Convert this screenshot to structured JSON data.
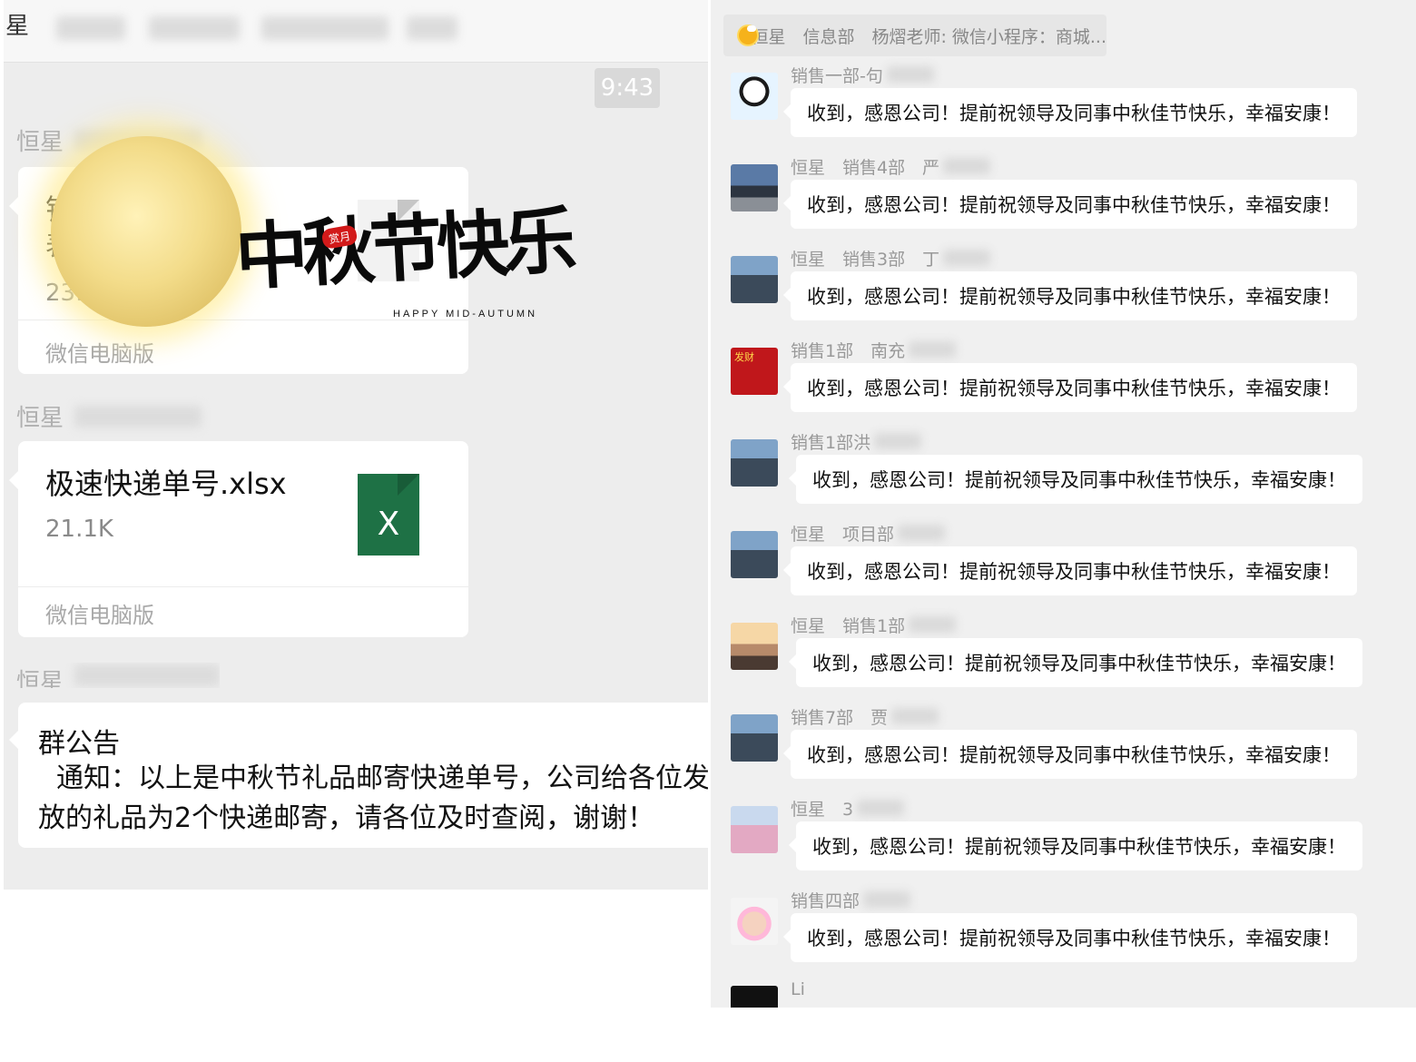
{
  "left_panel": {
    "title_fragment": "星",
    "time": "9:43",
    "senders": [
      "恒星",
      "恒星",
      "恒星"
    ],
    "file1": {
      "name_fragment": "销",
      "name_fragment2": "表",
      "size_fragment": "23.",
      "footer": "微信电脑版"
    },
    "file2": {
      "name": "极速快递单号.xlsx",
      "size": "21.1K",
      "icon_letter": "X",
      "footer": "微信电脑版"
    },
    "greeting": {
      "main": "中秋节快乐",
      "seal": "赏月",
      "english": "HAPPY MID-AUTUMN"
    },
    "notice": {
      "title": "群公告",
      "body": "通知：以上是中秋节礼品邮寄快递单号，公司给各位发放的礼品为2个快递邮寄，请各位及时查阅，谢谢！"
    }
  },
  "right_panel": {
    "header": "恒星　信息部　杨熠老师: 微信小程序：商城...",
    "colors": {
      "bubble": "#ffffff",
      "excel": "#1e7145"
    },
    "messages": [
      {
        "sender": "销售一部-句",
        "text": "收到，感恩公司！提前祝领导及同事中秋佳节快乐，幸福安康！",
        "avatar_icon": "panda-mascot-icon"
      },
      {
        "sender": "恒星　销售4部　严",
        "text": "收到，感恩公司！提前祝领导及同事中秋佳节快乐，幸福安康！",
        "avatar_icon": "building-photo-icon"
      },
      {
        "sender": "恒星　销售3部　丁",
        "text": "收到，感恩公司！提前祝领导及同事中秋佳节快乐，幸福安康！",
        "avatar_icon": "person-photo-icon"
      },
      {
        "sender": "销售1部　南充",
        "text": "收到，感恩公司！提前祝领导及同事中秋佳节快乐，幸福安康！",
        "avatar_icon": "lucky-cartoon-icon",
        "avatar_caption": "发财"
      },
      {
        "sender": "销售1部洪",
        "text": "收到，感恩公司！提前祝领导及同事中秋佳节快乐，幸福安康！",
        "avatar_icon": "person-photo-icon"
      },
      {
        "sender": "恒星　项目部",
        "text": "收到，感恩公司！提前祝领导及同事中秋佳节快乐，幸福安康！",
        "avatar_icon": "person-photo-icon"
      },
      {
        "sender": "恒星　销售1部",
        "text": "收到，感恩公司！提前祝领导及同事中秋佳节快乐，幸福安康！",
        "avatar_icon": "sunset-photo-icon"
      },
      {
        "sender": "销售7部　贾",
        "text": "收到，感恩公司！提前祝领导及同事中秋佳节快乐，幸福安康！",
        "avatar_icon": "person-photo-icon"
      },
      {
        "sender": "恒星　3",
        "text": "收到，感恩公司！提前祝领导及同事中秋佳节快乐，幸福安康！",
        "avatar_icon": "child-photo-icon"
      },
      {
        "sender": "销售四部",
        "text": "收到，感恩公司！提前祝领导及同事中秋佳节快乐，幸福安康！",
        "avatar_icon": "baby-photo-icon"
      }
    ],
    "last_sender": "Li"
  }
}
